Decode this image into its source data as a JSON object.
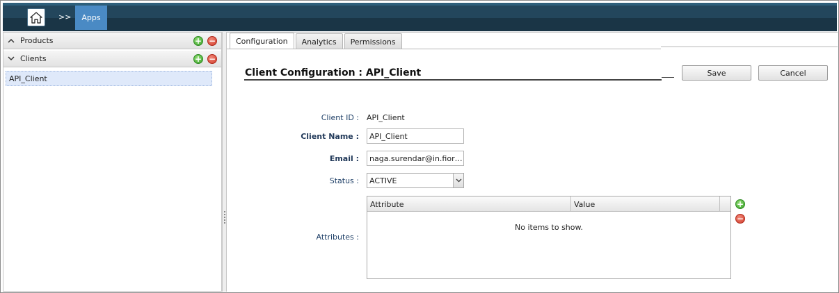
{
  "topbar": {
    "home_icon": "home-icon",
    "separator": ">>",
    "apps_label": "Apps"
  },
  "sidebar": {
    "sections": [
      {
        "label": "Products",
        "icon": "chevron-up-icon"
      },
      {
        "label": "Clients",
        "icon": "chevron-down-icon"
      }
    ],
    "clients": [
      "API_Client"
    ]
  },
  "tabs": [
    {
      "label": "Configuration",
      "active": true
    },
    {
      "label": "Analytics",
      "active": false
    },
    {
      "label": "Permissions",
      "active": false
    }
  ],
  "form": {
    "title": "Client Configuration : API_Client",
    "save_label": "Save",
    "cancel_label": "Cancel",
    "client_id_label": "Client ID :",
    "client_id_value": "API_Client",
    "client_name_label": "Client Name :",
    "client_name_value": "API_Client",
    "email_label": "Email :",
    "email_value": "naga.surendar@in.fior…",
    "status_label": "Status :",
    "status_value": "ACTIVE",
    "attributes_label": "Attributes :"
  },
  "attributes_grid": {
    "columns": [
      "Attribute",
      "Value"
    ],
    "empty_text": "No items to show."
  },
  "colors": {
    "topbar": "#1a3546",
    "apps_active": "#4a8ac4",
    "selection": "#dfe9fa",
    "add_green": "#3aa12a",
    "remove_red": "#d03a2a"
  }
}
